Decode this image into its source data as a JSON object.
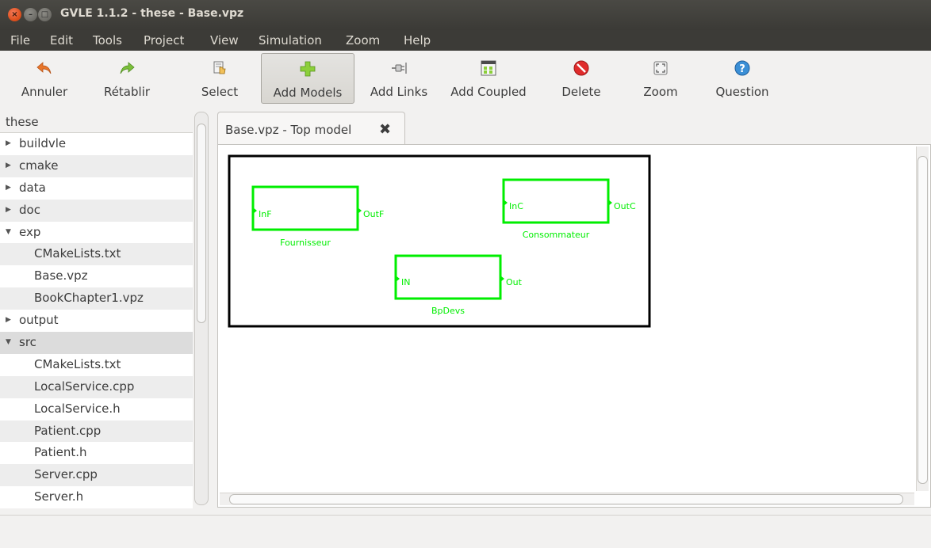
{
  "window": {
    "title": "GVLE 1.1.2 - these - Base.vpz"
  },
  "menu": [
    "File",
    "Edit",
    "Tools",
    "Project",
    "View",
    "Simulation",
    "Zoom",
    "Help"
  ],
  "toolbar": [
    {
      "label": "Annuler",
      "icon": "undo-arrow-icon"
    },
    {
      "label": "Rétablir",
      "icon": "redo-arrow-icon"
    },
    {
      "label": "Select",
      "icon": "select-hand-icon"
    },
    {
      "label": "Add Models",
      "icon": "add-plus-icon",
      "active": true
    },
    {
      "label": "Add Links",
      "icon": "plug-icon"
    },
    {
      "label": "Add Coupled",
      "icon": "coupled-grid-icon"
    },
    {
      "label": "Delete",
      "icon": "delete-circle-icon"
    },
    {
      "label": "Zoom",
      "icon": "zoom-fit-icon"
    },
    {
      "label": "Question",
      "icon": "help-question-icon"
    }
  ],
  "tree": {
    "header": "these",
    "items": [
      {
        "label": "buildvle",
        "type": "folder",
        "state": "collapsed"
      },
      {
        "label": "cmake",
        "type": "folder",
        "state": "collapsed"
      },
      {
        "label": "data",
        "type": "folder",
        "state": "collapsed"
      },
      {
        "label": "doc",
        "type": "folder",
        "state": "collapsed"
      },
      {
        "label": "exp",
        "type": "folder",
        "state": "expanded"
      },
      {
        "label": "CMakeLists.txt",
        "type": "file"
      },
      {
        "label": "Base.vpz",
        "type": "file"
      },
      {
        "label": "BookChapter1.vpz",
        "type": "file"
      },
      {
        "label": "output",
        "type": "folder",
        "state": "collapsed"
      },
      {
        "label": "src",
        "type": "folder",
        "state": "expanded"
      },
      {
        "label": "CMakeLists.txt",
        "type": "file"
      },
      {
        "label": "LocalService.cpp",
        "type": "file"
      },
      {
        "label": "LocalService.h",
        "type": "file"
      },
      {
        "label": "Patient.cpp",
        "type": "file"
      },
      {
        "label": "Patient.h",
        "type": "file"
      },
      {
        "label": "Server.cpp",
        "type": "file"
      },
      {
        "label": "Server.h",
        "type": "file"
      }
    ]
  },
  "editor": {
    "tab_label": "Base.vpz - Top model",
    "tab_close": "✖"
  },
  "models": [
    {
      "name": "Fournisseur",
      "in_port": "InF",
      "out_port": "OutF"
    },
    {
      "name": "Consommateur",
      "in_port": "InC",
      "out_port": "OutC"
    },
    {
      "name": "BpDevs",
      "in_port": "IN",
      "out_port": "Out"
    }
  ],
  "colors": {
    "model_border": "#00ee00",
    "titlebar_bg": "#3c3b37",
    "accent_orange": "#e0521f"
  }
}
